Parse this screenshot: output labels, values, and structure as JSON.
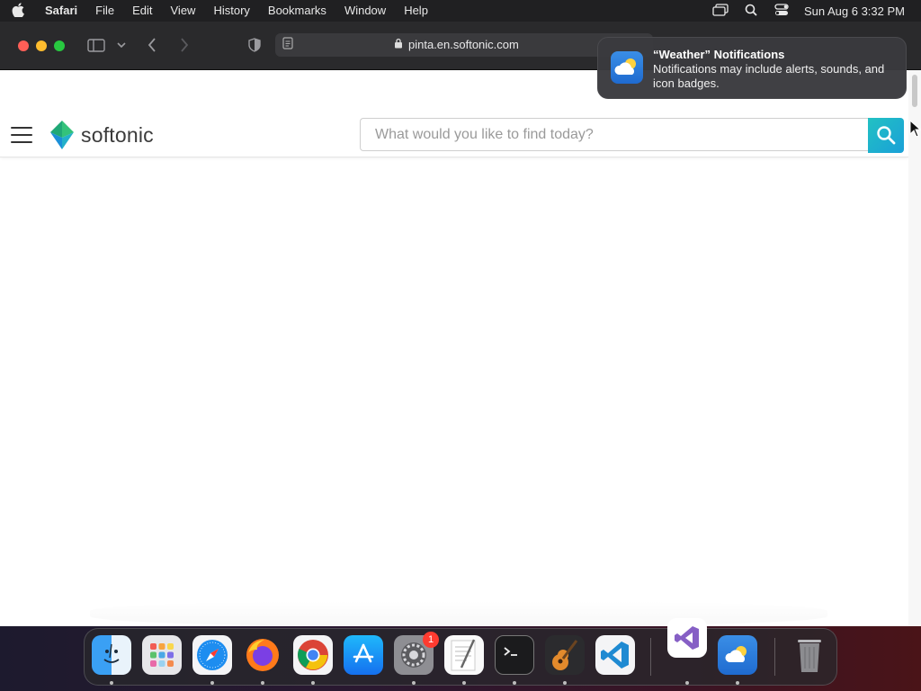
{
  "menubar": {
    "app_name": "Safari",
    "items": [
      "File",
      "Edit",
      "View",
      "History",
      "Bookmarks",
      "Window",
      "Help"
    ],
    "clock": "Sun Aug 6  3:32 PM"
  },
  "browser": {
    "url": "pinta.en.softonic.com"
  },
  "site": {
    "logo_text": "softonic",
    "search_placeholder": "What would you like to find today?",
    "brand_color": "#22c1c3"
  },
  "notification": {
    "title": "“Weather” Notifications",
    "body": "Notifications may include alerts, sounds, and icon badges."
  },
  "dock": {
    "settings_badge": "1",
    "apps": [
      "finder-icon",
      "launchpad-icon",
      "safari-icon",
      "firefox-icon",
      "chrome-icon",
      "app-store-icon",
      "system-settings-icon",
      "textedit-icon",
      "terminal-icon",
      "garageband-icon",
      "vscode-icon",
      "visual-studio-icon",
      "weather-icon",
      "trash-icon"
    ]
  }
}
